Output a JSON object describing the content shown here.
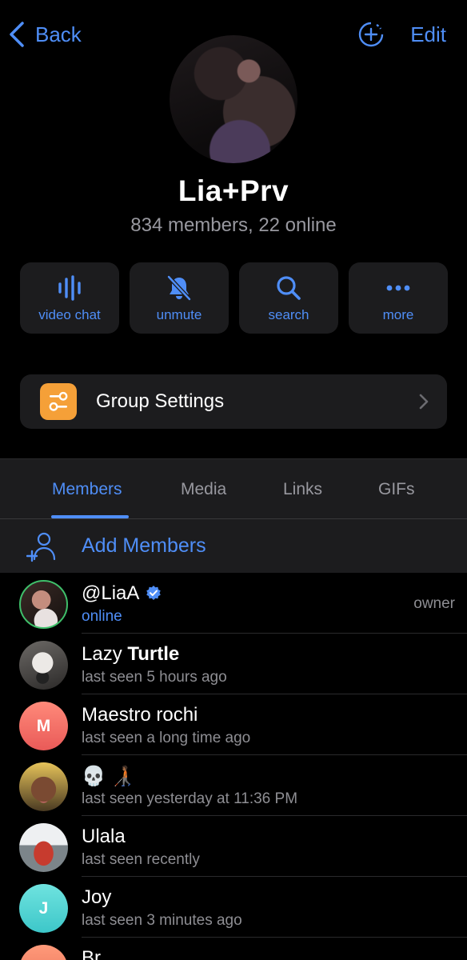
{
  "nav": {
    "back_label": "Back",
    "edit_label": "Edit"
  },
  "group": {
    "title": "Lia+Prv",
    "subtitle": "834 members, 22 online"
  },
  "actions": [
    {
      "label": "video chat",
      "icon": "voice-wave-icon"
    },
    {
      "label": "unmute",
      "icon": "bell-slash-icon"
    },
    {
      "label": "search",
      "icon": "magnifier-icon"
    },
    {
      "label": "more",
      "icon": "ellipsis-icon"
    }
  ],
  "settings": {
    "label": "Group Settings",
    "icon": "sliders-icon",
    "icon_color": "#f5a038"
  },
  "tabs": [
    {
      "label": "Members",
      "active": true
    },
    {
      "label": "Media"
    },
    {
      "label": "Links"
    },
    {
      "label": "GIFs"
    }
  ],
  "add_members": {
    "label": "Add Members"
  },
  "members": [
    {
      "name": "@LiaA",
      "status": "online",
      "role": "owner",
      "verified": true
    },
    {
      "name_part1": "Lazy",
      "name_part2": "Turtle",
      "status": "last seen 5 hours ago"
    },
    {
      "name": "Maestro rochi",
      "initial": "M",
      "status": "last seen a long time ago"
    },
    {
      "name": "💀 🧑🏾‍🦯",
      "status": "last seen yesterday at 11:36 PM"
    },
    {
      "name": "Ulala",
      "status": "last seen recently"
    },
    {
      "name": "Joy",
      "initial": "J",
      "status": "last seen 3 minutes ago"
    },
    {
      "name": "Br"
    }
  ],
  "colors": {
    "accent": "#4f8ef7",
    "background": "#000000",
    "card": "#1c1c1e",
    "secondary_text": "#8e8e93"
  }
}
